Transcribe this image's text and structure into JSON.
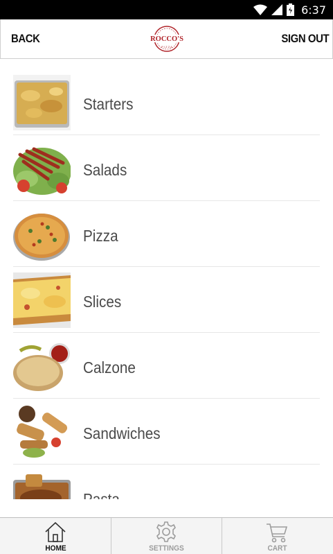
{
  "status_bar": {
    "time": "6:37",
    "icons": [
      "wifi-icon",
      "signal-icon",
      "battery-icon"
    ]
  },
  "header": {
    "back_label": "BACK",
    "sign_out_label": "SIGN OUT",
    "logo_text": "ROCCO'S",
    "colors": {
      "logo_red": "#b0242a"
    }
  },
  "menu": {
    "items": [
      {
        "label": "Starters",
        "image": "starters-photo"
      },
      {
        "label": "Salads",
        "image": "salads-photo"
      },
      {
        "label": "Pizza",
        "image": "pizza-photo"
      },
      {
        "label": "Slices",
        "image": "slices-photo"
      },
      {
        "label": "Calzone",
        "image": "calzone-photo"
      },
      {
        "label": "Sandwiches",
        "image": "sandwiches-photo"
      },
      {
        "label": "Pasta",
        "image": "pasta-photo"
      }
    ]
  },
  "tab_bar": {
    "tabs": [
      {
        "label": "HOME",
        "icon": "home-icon",
        "active": true
      },
      {
        "label": "SETTINGS",
        "icon": "gear-icon",
        "active": false
      },
      {
        "label": "CART",
        "icon": "cart-icon",
        "active": false
      }
    ]
  }
}
